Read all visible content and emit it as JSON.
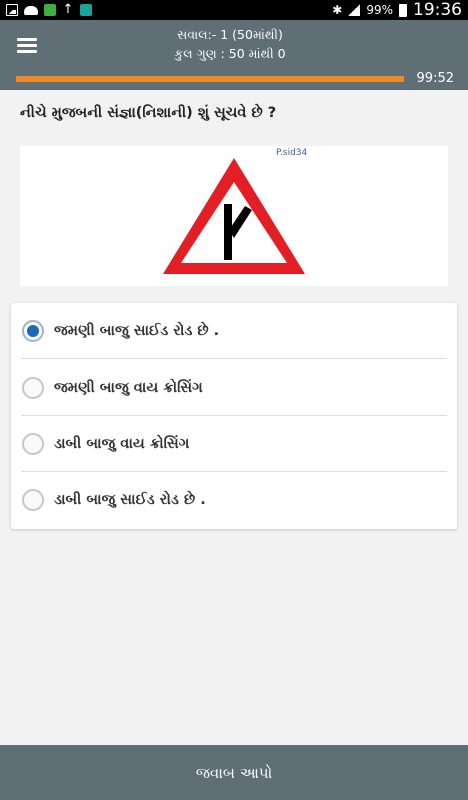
{
  "status_bar": {
    "battery": "99%",
    "time": "19:36",
    "icons": [
      "gallery-icon",
      "cloud-icon",
      "app-icon",
      "upload-icon",
      "app-icon",
      "bluetooth-icon",
      "signal-icon",
      "battery-icon"
    ]
  },
  "header": {
    "menu_icon": "menu-icon",
    "question_counter": "સવાલ:- 1 (50માંથી)",
    "score": "કુલ ગુણ : 50 માંથી 0"
  },
  "progress": {
    "value": 1.0,
    "timer": "99:52",
    "color": "#ef8a26"
  },
  "question": {
    "text": "નીચે મુજબની સંજ્ઞા(નિશાની) શું સૂચવે છે ?",
    "image_watermark": "P.sid34"
  },
  "options": [
    {
      "label": "જમણી બાજુ સાઈડ રોડ છે .",
      "selected": true
    },
    {
      "label": "જમણી બાજુ વાય ક્રોસિંગ",
      "selected": false
    },
    {
      "label": "ડાબી બાજુ વાય ક્રોસિંગ",
      "selected": false
    },
    {
      "label": "ડાબી બાજુ સાઈડ રોડ છે .",
      "selected": false
    }
  ],
  "footer": {
    "submit_label": "જવાબ આપો"
  },
  "colors": {
    "header_bg": "#5f6f75",
    "accent_orange": "#ef8a26",
    "radio_selected": "#1f67b8",
    "sign_red": "#e31e24"
  }
}
